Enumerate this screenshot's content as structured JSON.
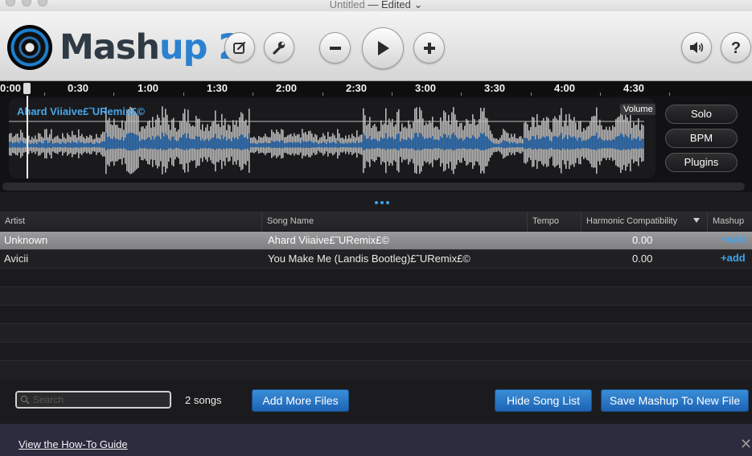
{
  "window": {
    "title": "Untitled",
    "separator": "—",
    "status": "Edited"
  },
  "app": {
    "logo_primary": "Mash",
    "logo_accent": "up 2",
    "brand_color": "#2a82cf"
  },
  "toolbar": {
    "icons": [
      "edit-icon",
      "wrench-icon",
      "minus-icon",
      "play-icon",
      "plus-icon",
      "speaker-icon",
      "help-icon"
    ]
  },
  "timeline": {
    "ticks": [
      "0:00",
      "0:30",
      "1:00",
      "1:30",
      "2:00",
      "2:30",
      "3:00",
      "3:30",
      "4:00",
      "4:30"
    ]
  },
  "track": {
    "song_label": "Ahard Viiaive£˜URemix£©",
    "volume_label": "Volume",
    "buttons": {
      "solo": "Solo",
      "bpm": "BPM",
      "plugins": "Plugins"
    }
  },
  "table": {
    "headers": {
      "artist": "Artist",
      "song_name": "Song Name",
      "tempo": "Tempo",
      "harmonic": "Harmonic Compatibility",
      "mashup": "Mashup"
    },
    "rows": [
      {
        "artist": "Unknown",
        "song": "Ahard Viiaive£˜URemix£©",
        "tempo": "",
        "harmonic": "0.00",
        "mashup": "+add"
      },
      {
        "artist": "Avicii",
        "song": "You Make Me (Landis Bootleg)£˜URemix£©",
        "tempo": "",
        "harmonic": "0.00",
        "mashup": "+add"
      }
    ]
  },
  "bottom": {
    "search_placeholder": "Search",
    "song_count": "2 songs",
    "add_more_files": "Add More Files",
    "hide_song_list": "Hide Song List",
    "save_mashup": "Save Mashup To New File"
  },
  "footer": {
    "howto_link": "View the How-To Guide",
    "close_glyph": "✕"
  },
  "colors": {
    "accent_blue": "#3ea3ec",
    "button_blue": "#2a7acb",
    "waveform": "#b8b8b8",
    "waveform_inner": "#2e6fb4"
  }
}
